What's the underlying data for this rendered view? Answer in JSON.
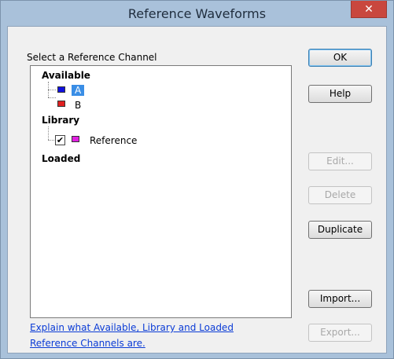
{
  "window": {
    "title": "Reference Waveforms",
    "close_glyph": "✕"
  },
  "group_label": "Select a Reference Channel",
  "tree": {
    "available": {
      "label": "Available",
      "items": [
        {
          "label": "A",
          "color": "#1010e0",
          "selected": true
        },
        {
          "label": "B",
          "color": "#e02020",
          "selected": false
        }
      ]
    },
    "library": {
      "label": "Library",
      "items": [
        {
          "label": "Reference",
          "color": "#e020e0",
          "checked": true,
          "check_glyph": "✔"
        }
      ]
    },
    "loaded": {
      "label": "Loaded"
    }
  },
  "help_link": {
    "line1": "Explain what Available, Library and Loaded",
    "line2": "Reference Channels are."
  },
  "buttons": {
    "ok": "OK",
    "help": "Help",
    "edit": "Edit...",
    "delete": "Delete",
    "duplicate": "Duplicate",
    "import": "Import...",
    "export": "Export..."
  }
}
